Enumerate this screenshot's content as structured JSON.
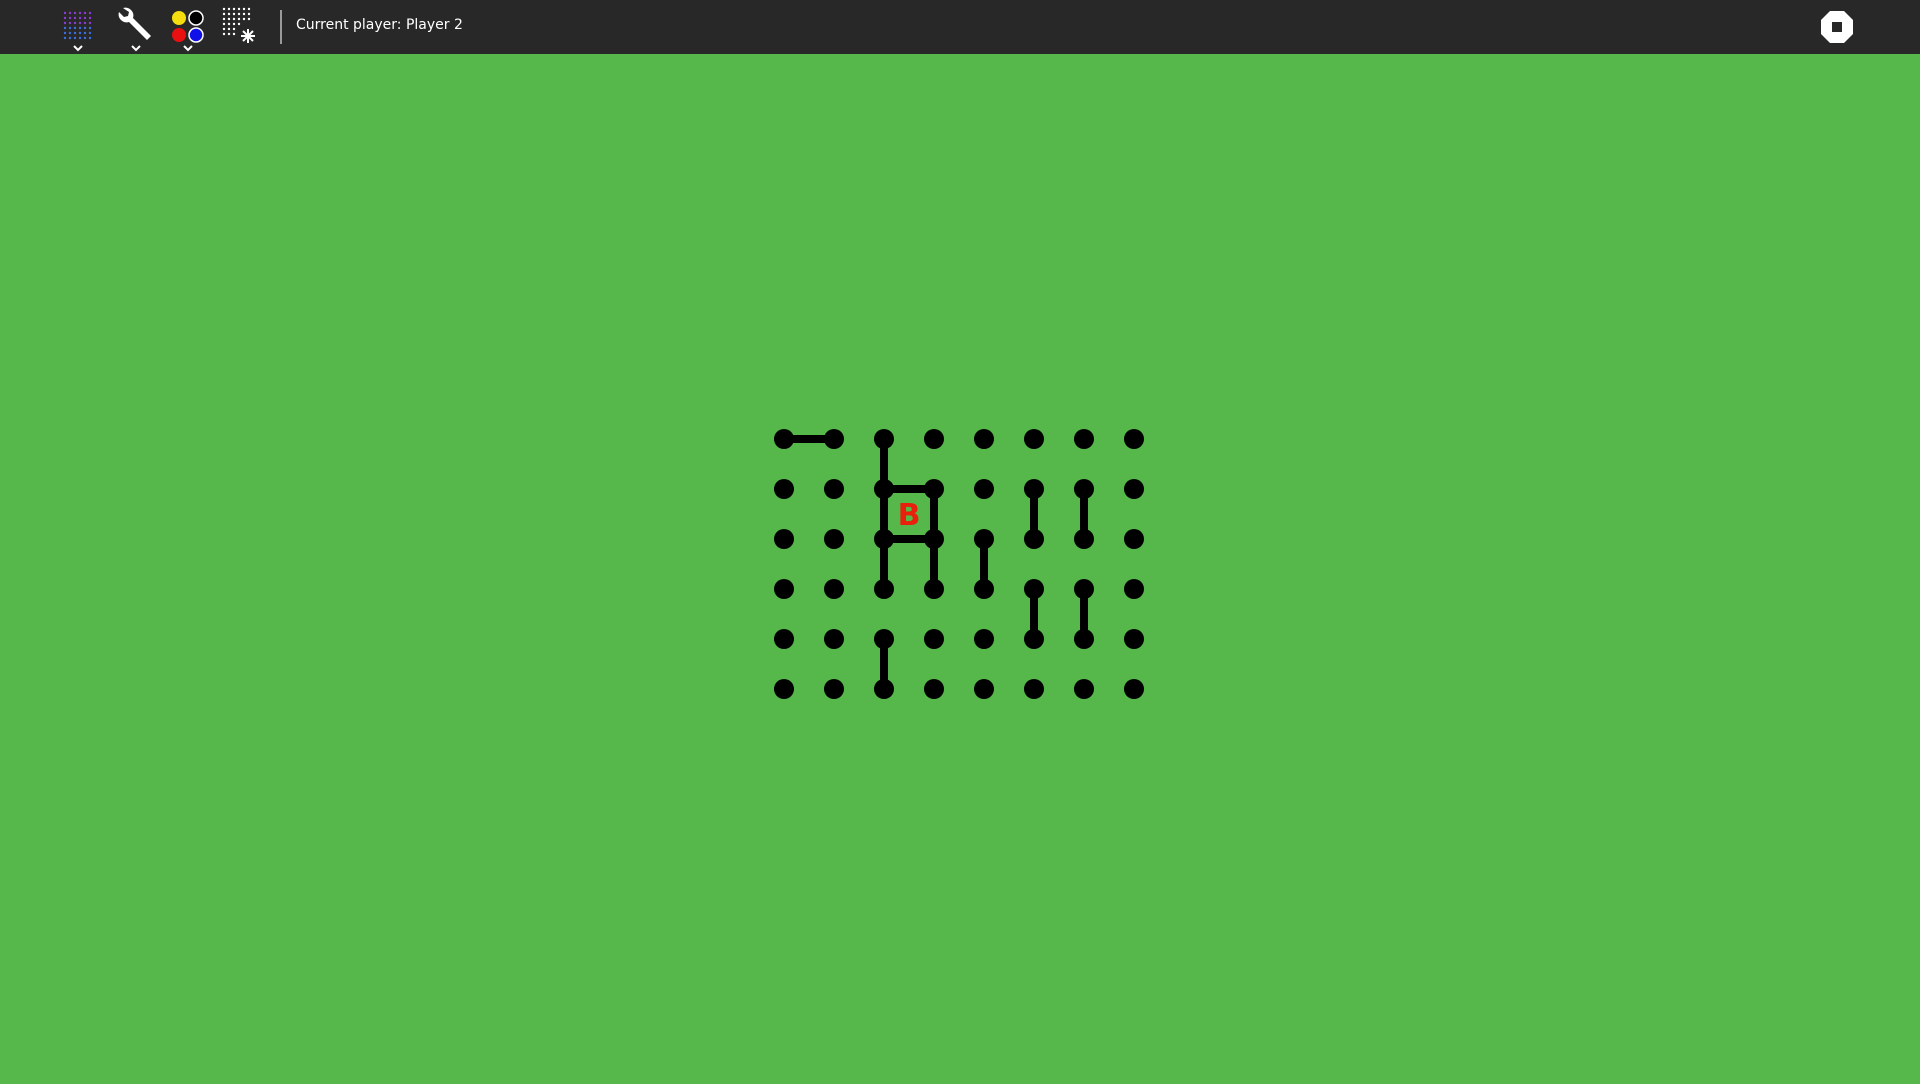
{
  "toolbar": {
    "tools": [
      {
        "name": "game-size-icon"
      },
      {
        "name": "wrench-icon"
      },
      {
        "name": "player-colors-icon"
      },
      {
        "name": "new-game-icon"
      }
    ],
    "current_player_label": "Current player:",
    "current_player_value": "Player 2",
    "stop_icon": "stop-icon"
  },
  "game": {
    "cols": 8,
    "rows": 6,
    "dot_color": "#000000",
    "background_color": "#56b84a",
    "owner_color": "#e8200c",
    "lines": [
      {
        "from": [
          0,
          0
        ],
        "to": [
          1,
          0
        ]
      },
      {
        "from": [
          2,
          0
        ],
        "to": [
          2,
          1
        ]
      },
      {
        "from": [
          2,
          1
        ],
        "to": [
          3,
          1
        ]
      },
      {
        "from": [
          2,
          1
        ],
        "to": [
          2,
          2
        ]
      },
      {
        "from": [
          3,
          1
        ],
        "to": [
          3,
          2
        ]
      },
      {
        "from": [
          2,
          2
        ],
        "to": [
          3,
          2
        ]
      },
      {
        "from": [
          2,
          2
        ],
        "to": [
          2,
          3
        ]
      },
      {
        "from": [
          3,
          2
        ],
        "to": [
          3,
          3
        ]
      },
      {
        "from": [
          4,
          2
        ],
        "to": [
          4,
          3
        ]
      },
      {
        "from": [
          5,
          1
        ],
        "to": [
          5,
          2
        ]
      },
      {
        "from": [
          6,
          1
        ],
        "to": [
          6,
          2
        ]
      },
      {
        "from": [
          5,
          3
        ],
        "to": [
          5,
          4
        ]
      },
      {
        "from": [
          6,
          3
        ],
        "to": [
          6,
          4
        ]
      },
      {
        "from": [
          2,
          4
        ],
        "to": [
          2,
          5
        ]
      }
    ],
    "boxes": [
      {
        "col": 2,
        "row": 1,
        "owner": "B"
      }
    ]
  }
}
